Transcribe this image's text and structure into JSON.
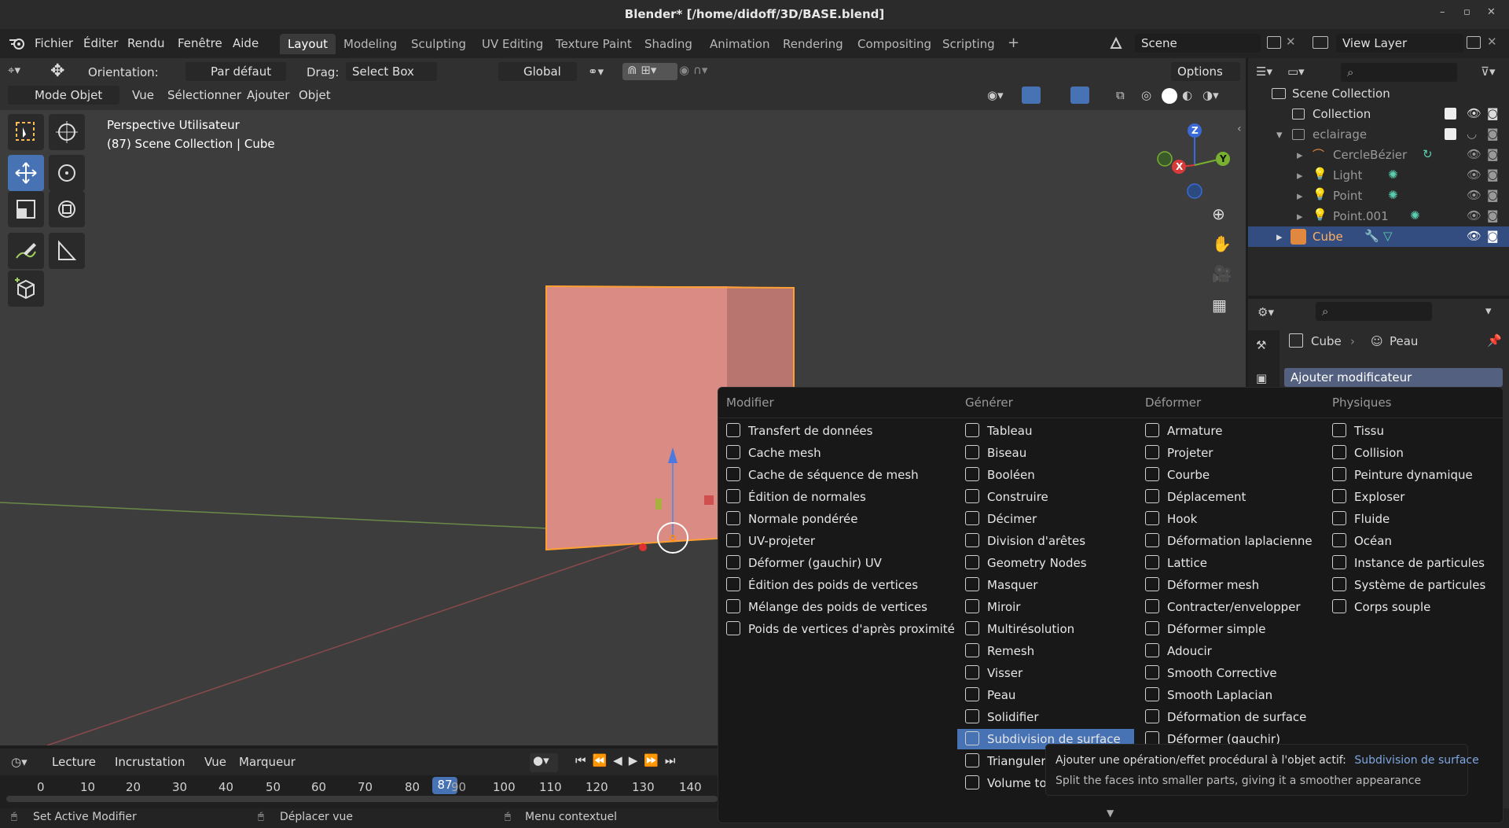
{
  "window": {
    "title": "Blender* [/home/didoff/3D/BASE.blend]",
    "minimize": "–",
    "maximize": "▫",
    "close": "✕"
  },
  "menubar": {
    "menus": [
      "Fichier",
      "Éditer",
      "Rendu",
      "Fenêtre",
      "Aide"
    ],
    "workspaces": [
      "Layout",
      "Modeling",
      "Sculpting",
      "UV Editing",
      "Texture Paint",
      "Shading",
      "Animation",
      "Rendering",
      "Compositing",
      "Scripting"
    ],
    "add_tab": "+",
    "scene": "Scene",
    "view_layer": "View Layer"
  },
  "toolheader": {
    "orientation_label": "Orientation:",
    "orientation_value": "Par défaut",
    "drag_label": "Drag:",
    "drag_value": "Select Box",
    "transform": "Global",
    "options": "Options"
  },
  "viewport_header": {
    "mode": "Mode Objet",
    "menus": [
      "Vue",
      "Sélectionner",
      "Ajouter",
      "Objet"
    ]
  },
  "viewport": {
    "info_line1": "Perspective Utilisateur",
    "info_line2": "(87) Scene Collection | Cube",
    "gizmo": {
      "x": "X",
      "y": "Y",
      "z": "Z"
    }
  },
  "outliner": {
    "rows": [
      {
        "name": "Scene Collection"
      },
      {
        "name": "Collection"
      },
      {
        "name": "eclairage"
      },
      {
        "name": "CercleBézier"
      },
      {
        "name": "Light"
      },
      {
        "name": "Point"
      },
      {
        "name": "Point.001"
      },
      {
        "name": "Cube"
      }
    ]
  },
  "properties": {
    "object": "Cube",
    "modifier": "Peau",
    "add_modifier": "Ajouter modificateur"
  },
  "modifier_menu": {
    "columns": [
      {
        "header": "Modifier",
        "items": [
          "Transfert de données",
          "Cache mesh",
          "Cache de séquence de mesh",
          "Édition de normales",
          "Normale pondérée",
          "UV-projeter",
          "Déformer (gauchir) UV",
          "Édition des poids de vertices",
          "Mélange des poids de vertices",
          "Poids de vertices d'après proximité"
        ]
      },
      {
        "header": "Générer",
        "items": [
          "Tableau",
          "Biseau",
          "Booléen",
          "Construire",
          "Décimer",
          "Division d'arêtes",
          "Geometry Nodes",
          "Masquer",
          "Miroir",
          "Multirésolution",
          "Remesh",
          "Visser",
          "Peau",
          "Solidifier",
          "Subdivision de surface",
          "Trianguler",
          "Volume to"
        ]
      },
      {
        "header": "Déformer",
        "items": [
          "Armature",
          "Projeter",
          "Courbe",
          "Déplacement",
          "Hook",
          "Déformation laplacienne",
          "Lattice",
          "Déformer mesh",
          "Contracter/envelopper",
          "Déformer simple",
          "Adoucir",
          "Smooth Corrective",
          "Smooth Laplacian",
          "Déformation de surface",
          "Déformer (gauchir)"
        ]
      },
      {
        "header": "Physiques",
        "items": [
          "Tissu",
          "Collision",
          "Peinture dynamique",
          "Exploser",
          "Fluide",
          "Océan",
          "Instance de particules",
          "Système de particules",
          "Corps souple"
        ]
      }
    ],
    "highlighted": "Subdivision de surface"
  },
  "tooltip": {
    "prefix": "Ajouter une opération/effet procédural à l'objet actif:",
    "name": "Subdivision de surface",
    "desc": "Split the faces into smaller parts, giving it a smoother appearance"
  },
  "timeline": {
    "menus": [
      "Lecture",
      "Incrustation",
      "Vue",
      "Marqueur"
    ],
    "current_frame": "87",
    "ticks": [
      "0",
      "10",
      "20",
      "30",
      "40",
      "50",
      "60",
      "70",
      "80",
      "90",
      "100",
      "110",
      "120",
      "130",
      "140"
    ]
  },
  "statusbar": {
    "left": "Set Active Modifier",
    "middle": "Déplacer vue",
    "right": "Menu contextuel"
  },
  "colors": {
    "accent": "#4772b3",
    "cube": "#d98b84",
    "outline": "#ffa033"
  }
}
